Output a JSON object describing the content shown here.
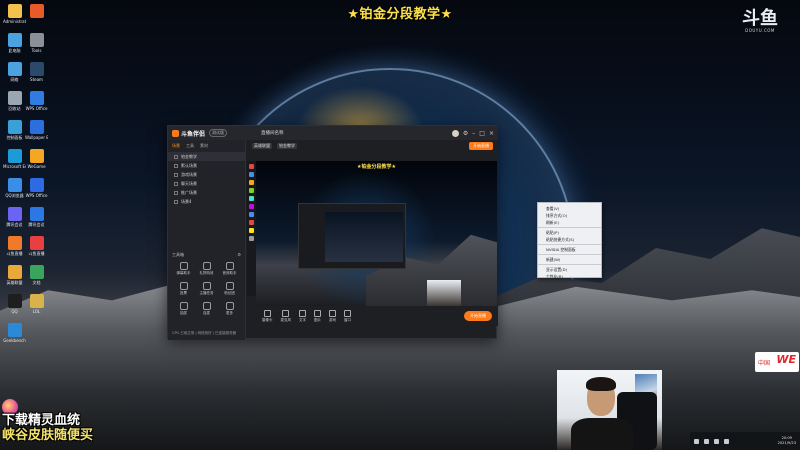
{
  "stream": {
    "title": "★铂金分段教学★",
    "brand_mark": "斗鱼",
    "brand_sub": "DOUYU.COM"
  },
  "desktop_icons": [
    {
      "label": "Administrat",
      "color": "#f2c14e"
    },
    {
      "label": "",
      "color": "#e85a2a"
    },
    {
      "label": "此电脑",
      "color": "#4aa3e0"
    },
    {
      "label": "Tools",
      "color": "#8a8f98"
    },
    {
      "label": "网络",
      "color": "#4aa3e0"
    },
    {
      "label": "Steam",
      "color": "#2b4a6b"
    },
    {
      "label": "回收站",
      "color": "#9aa6b2"
    },
    {
      "label": "WPS Office",
      "color": "#2f7de1"
    },
    {
      "label": "控制面板",
      "color": "#3aa0d8"
    },
    {
      "label": "Wallpaper Engine",
      "color": "#2a6fdb"
    },
    {
      "label": "Microsoft Edge",
      "color": "#1d9bd7"
    },
    {
      "label": "WeGame",
      "color": "#f5a623"
    },
    {
      "label": "QQ浏览器",
      "color": "#3b8ee8"
    },
    {
      "label": "WPS Office",
      "color": "#2d6ae3"
    },
    {
      "label": "腾讯会议",
      "color": "#6b63f2"
    },
    {
      "label": "腾讯会议",
      "color": "#2b78e4"
    },
    {
      "label": "斗鱼直播",
      "color": "#f07a2a"
    },
    {
      "label": "斗鱼直播",
      "color": "#e84040"
    },
    {
      "label": "英雄联盟",
      "color": "#e8a93a"
    },
    {
      "label": "文档",
      "color": "#3aa35c"
    },
    {
      "label": "QQ",
      "color": "#1e1e1e"
    },
    {
      "label": "LOL",
      "color": "#d8b24a"
    },
    {
      "label": "Geekbench",
      "color": "#2a8ad8"
    }
  ],
  "app": {
    "name": "斗鱼伴侣",
    "version": "测试版",
    "stream_name": "直播间名称",
    "tabs": [
      "场景",
      "工具",
      "素材"
    ],
    "scenes": [
      {
        "label": "铂金教学"
      },
      {
        "label": "默认场景"
      },
      {
        "label": "游戏场景"
      },
      {
        "label": "聊天场景"
      },
      {
        "label": "推广场景"
      },
      {
        "label": "场景4"
      }
    ],
    "toolbox_title": "工具箱",
    "tools": [
      {
        "label": "弹幕助手"
      },
      {
        "label": "礼物特效"
      },
      {
        "label": "音效助手"
      },
      {
        "label": "投票"
      },
      {
        "label": "主播任务"
      },
      {
        "label": "粉丝团"
      },
      {
        "label": "抽奖"
      },
      {
        "label": "连麦"
      },
      {
        "label": "更多"
      }
    ],
    "sub_tags": [
      "英雄联盟",
      "铂金教学"
    ],
    "go_live_label": "开始直播",
    "preview_title": "★铂金分段教学★",
    "bottom_tools": [
      {
        "label": "摄像头"
      },
      {
        "label": "麦克风"
      },
      {
        "label": "文字"
      },
      {
        "label": "图片"
      },
      {
        "label": "游戏"
      },
      {
        "label": "窗口"
      }
    ],
    "status": "CPU 占用正常 | 网络良好 | 已连接服务器"
  },
  "context_menu": {
    "items": [
      "查看(V)",
      "排序方式(O)",
      "刷新(E)",
      "粘贴(P)",
      "粘贴快捷方式(S)",
      "NVIDIA 控制面板",
      "新建(W)",
      "显示设置(D)",
      "个性化(R)"
    ]
  },
  "overlay": {
    "promo_line1": "下载精灵血统",
    "promo_line2": "峡谷皮肤随便买",
    "team_logo": "WE",
    "team_cn": "中国"
  },
  "tray": {
    "time": "20:09",
    "date": "2021/9/23"
  }
}
